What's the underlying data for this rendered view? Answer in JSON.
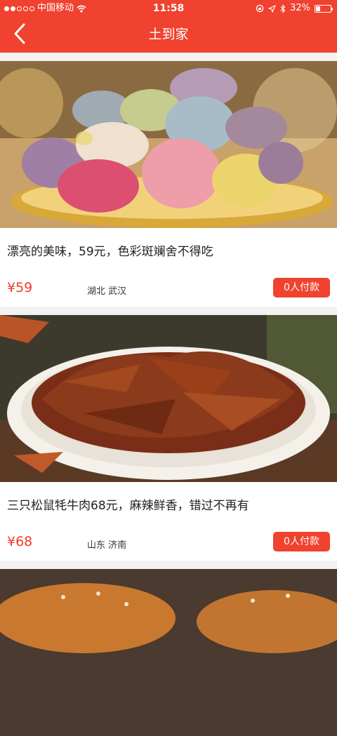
{
  "status_bar": {
    "carrier": "中国移动",
    "time": "11:58",
    "battery_percent": "32%",
    "battery_level": 0.32,
    "signal_dots_filled": 2,
    "signal_dots_total": 5
  },
  "nav": {
    "title": "土到家",
    "back_icon": "chevron-left-icon"
  },
  "colors": {
    "accent": "#f0422f",
    "price": "#ef3b24",
    "background": "#f2f2f2"
  },
  "items": [
    {
      "title": "漂亮的美味，59元，色彩斑斓舍不得吃",
      "price": "¥59",
      "location": "湖北 武汉",
      "pay_count": "0人付款",
      "image": "macarons-photo"
    },
    {
      "title": "三只松鼠牦牛肉68元，麻辣鲜香，错过不再有",
      "price": "¥68",
      "location": "山东 济南",
      "pay_count": "0人付款",
      "image": "spicy-yak-jerky-photo"
    },
    {
      "image": "sesame-bread-photo"
    }
  ]
}
